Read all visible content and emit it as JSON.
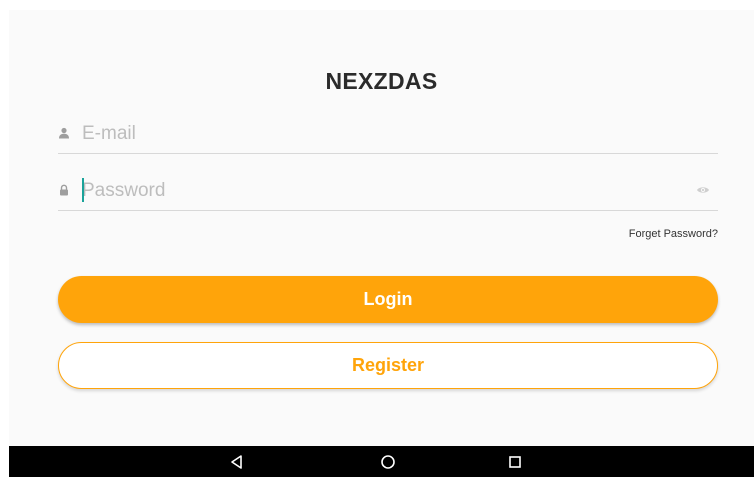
{
  "app": {
    "title": "NEXZDAS"
  },
  "form": {
    "email": {
      "placeholder": "E-mail",
      "icon": "person-icon"
    },
    "password": {
      "placeholder": "Password",
      "icon": "lock-icon",
      "toggle_icon": "eye-icon"
    },
    "forget_password": "Forget Password?"
  },
  "buttons": {
    "login": "Login",
    "register": "Register"
  },
  "navigation_bar": {
    "buttons": [
      "back-icon",
      "home-icon",
      "recents-icon"
    ]
  },
  "colors": {
    "accent": "#ffa40a",
    "cursor": "#1aa39a",
    "background": "#fafafa",
    "navbar": "#000000"
  }
}
